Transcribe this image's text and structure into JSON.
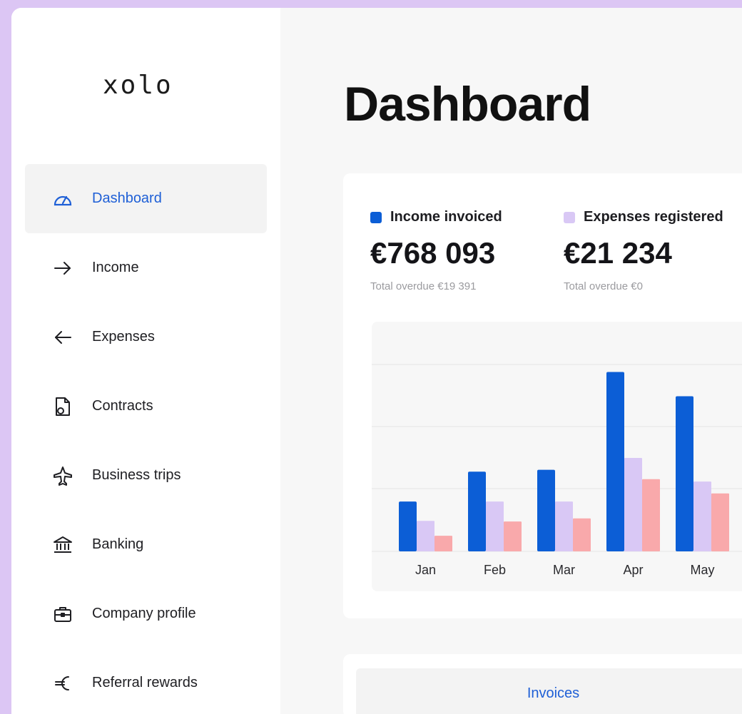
{
  "app": {
    "logo": "xolo"
  },
  "sidebar": {
    "items": [
      {
        "label": "Dashboard",
        "icon": "dashboard-gauge-icon",
        "active": true
      },
      {
        "label": "Income",
        "icon": "arrow-right-icon"
      },
      {
        "label": "Expenses",
        "icon": "arrow-left-icon"
      },
      {
        "label": "Contracts",
        "icon": "contract-document-icon"
      },
      {
        "label": "Business trips",
        "icon": "airplane-icon"
      },
      {
        "label": "Banking",
        "icon": "bank-icon"
      },
      {
        "label": "Company profile",
        "icon": "briefcase-icon"
      },
      {
        "label": "Referral rewards",
        "icon": "euro-icon"
      }
    ]
  },
  "main": {
    "title": "Dashboard",
    "summary": {
      "income": {
        "label": "Income invoiced",
        "amount": "€768 093",
        "overdue": "Total overdue €19 391",
        "color": "#0c5ed6"
      },
      "expenses": {
        "label": "Expenses registered",
        "amount": "€21 234",
        "overdue": "Total overdue €0",
        "color": "#d9c8f5"
      }
    },
    "tabs": [
      {
        "label": "Invoices",
        "active": true
      }
    ]
  },
  "chart_data": {
    "type": "bar",
    "categories": [
      "Jan",
      "Feb",
      "Mar",
      "Apr",
      "May"
    ],
    "series": [
      {
        "name": "Income invoiced",
        "color": "#0c5ed6",
        "values": [
          80,
          128,
          131,
          288,
          249
        ]
      },
      {
        "name": "Expenses registered",
        "color": "#d9c8f5",
        "values": [
          49,
          80,
          80,
          150,
          112
        ]
      },
      {
        "color": "#f9a9ab",
        "values": [
          25,
          48,
          53,
          116,
          93
        ]
      }
    ],
    "ylim": [
      0,
      300
    ],
    "grid": true
  }
}
